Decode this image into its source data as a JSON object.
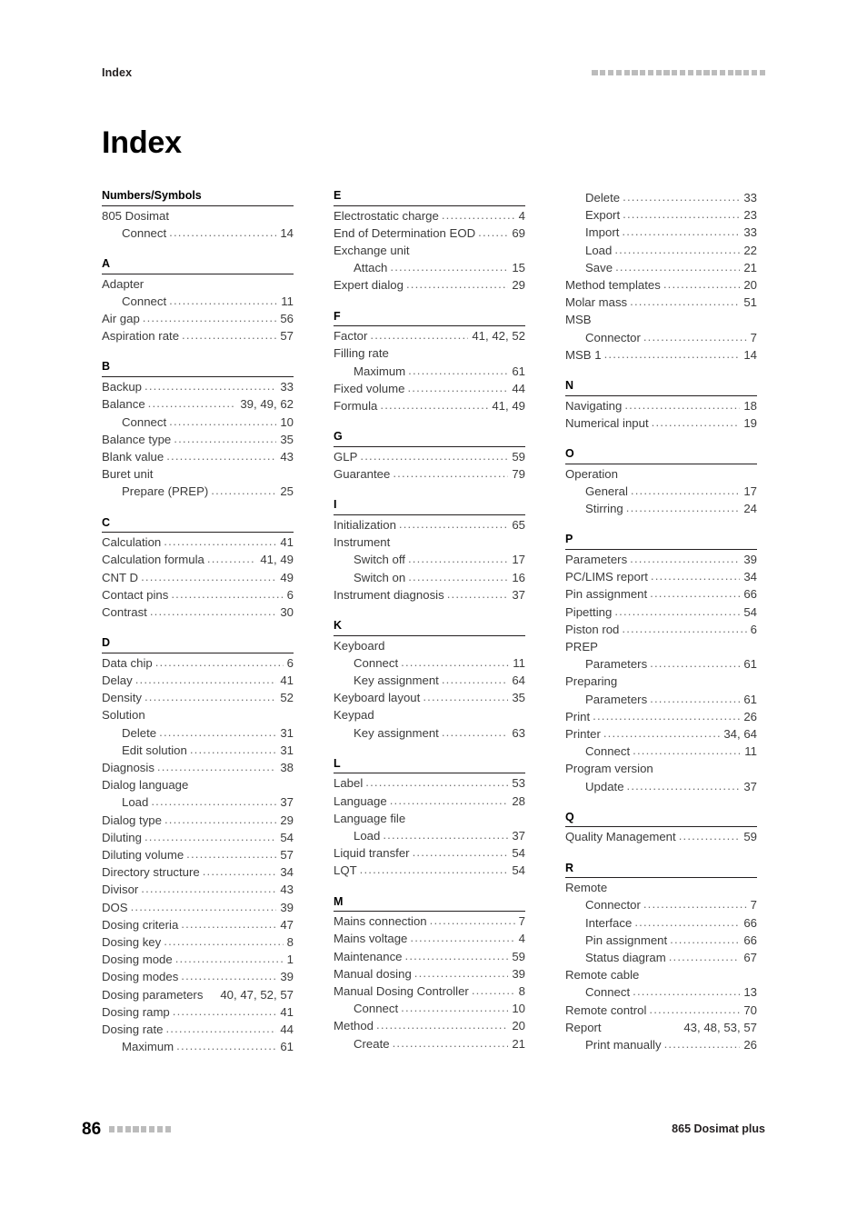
{
  "header": {
    "running_title": "Index",
    "decoration_squares": 22
  },
  "title": "Index",
  "footer": {
    "page_number": "86",
    "decoration_squares": 8,
    "document_title": "865 Dosimat plus"
  },
  "columns": [
    {
      "id": "column-1",
      "sections": [
        {
          "letter": "Numbers/Symbols",
          "entries": [
            {
              "text": "805 Dosimat",
              "pages": "",
              "level": 0,
              "dots": false
            },
            {
              "text": "Connect",
              "pages": "14",
              "level": 1,
              "dots": true
            }
          ]
        },
        {
          "letter": "A",
          "entries": [
            {
              "text": "Adapter",
              "pages": "",
              "level": 0,
              "dots": false
            },
            {
              "text": "Connect",
              "pages": "11",
              "level": 1,
              "dots": true
            },
            {
              "text": "Air gap",
              "pages": "56",
              "level": 0,
              "dots": true
            },
            {
              "text": "Aspiration rate",
              "pages": "57",
              "level": 0,
              "dots": true
            }
          ]
        },
        {
          "letter": "B",
          "entries": [
            {
              "text": "Backup",
              "pages": "33",
              "level": 0,
              "dots": true
            },
            {
              "text": "Balance",
              "pages": "39, 49, 62",
              "level": 0,
              "dots": true
            },
            {
              "text": "Connect",
              "pages": "10",
              "level": 1,
              "dots": true
            },
            {
              "text": "Balance type",
              "pages": "35",
              "level": 0,
              "dots": true
            },
            {
              "text": "Blank value",
              "pages": "43",
              "level": 0,
              "dots": true
            },
            {
              "text": "Buret unit",
              "pages": "",
              "level": 0,
              "dots": false
            },
            {
              "text": "Prepare (PREP)",
              "pages": "25",
              "level": 1,
              "dots": true
            }
          ]
        },
        {
          "letter": "C",
          "entries": [
            {
              "text": "Calculation",
              "pages": "41",
              "level": 0,
              "dots": true
            },
            {
              "text": "Calculation formula",
              "pages": "41, 49",
              "level": 0,
              "dots": true
            },
            {
              "text": "CNT D",
              "pages": "49",
              "level": 0,
              "dots": true
            },
            {
              "text": "Contact pins",
              "pages": "6",
              "level": 0,
              "dots": true
            },
            {
              "text": "Contrast",
              "pages": "30",
              "level": 0,
              "dots": true
            }
          ]
        },
        {
          "letter": "D",
          "entries": [
            {
              "text": "Data chip",
              "pages": "6",
              "level": 0,
              "dots": true
            },
            {
              "text": "Delay",
              "pages": "41",
              "level": 0,
              "dots": true
            },
            {
              "text": "Density",
              "pages": "52",
              "level": 0,
              "dots": true
            },
            {
              "text": "Solution",
              "pages": "",
              "level": 0,
              "dots": false
            },
            {
              "text": "Delete",
              "pages": "31",
              "level": 1,
              "dots": true
            },
            {
              "text": "Edit solution",
              "pages": "31",
              "level": 1,
              "dots": true
            },
            {
              "text": "Diagnosis",
              "pages": "38",
              "level": 0,
              "dots": true
            },
            {
              "text": "Dialog language",
              "pages": "",
              "level": 0,
              "dots": false
            },
            {
              "text": "Load",
              "pages": "37",
              "level": 1,
              "dots": true
            },
            {
              "text": "Dialog type",
              "pages": "29",
              "level": 0,
              "dots": true
            },
            {
              "text": "Diluting",
              "pages": "54",
              "level": 0,
              "dots": true
            },
            {
              "text": "Diluting volume",
              "pages": "57",
              "level": 0,
              "dots": true
            },
            {
              "text": "Directory structure",
              "pages": "34",
              "level": 0,
              "dots": true
            },
            {
              "text": "Divisor",
              "pages": "43",
              "level": 0,
              "dots": true
            },
            {
              "text": "DOS",
              "pages": "39",
              "level": 0,
              "dots": true
            },
            {
              "text": "Dosing criteria",
              "pages": "47",
              "level": 0,
              "dots": true
            },
            {
              "text": "Dosing key",
              "pages": "8",
              "level": 0,
              "dots": true
            },
            {
              "text": "Dosing mode",
              "pages": "1",
              "level": 0,
              "dots": true
            },
            {
              "text": "Dosing modes",
              "pages": "39",
              "level": 0,
              "dots": true
            },
            {
              "text": "Dosing parameters",
              "pages": "40, 47, 52, 57",
              "level": 0,
              "dots": false
            },
            {
              "text": "Dosing ramp",
              "pages": "41",
              "level": 0,
              "dots": true
            },
            {
              "text": "Dosing rate",
              "pages": "44",
              "level": 0,
              "dots": true
            },
            {
              "text": "Maximum",
              "pages": "61",
              "level": 1,
              "dots": true
            }
          ]
        }
      ]
    },
    {
      "id": "column-2",
      "sections": [
        {
          "letter": "E",
          "entries": [
            {
              "text": "Electrostatic charge",
              "pages": "4",
              "level": 0,
              "dots": true
            },
            {
              "text": "End of Determination EOD",
              "pages": "69",
              "level": 0,
              "dots": true
            },
            {
              "text": "Exchange unit",
              "pages": "",
              "level": 0,
              "dots": false
            },
            {
              "text": "Attach",
              "pages": "15",
              "level": 1,
              "dots": true
            },
            {
              "text": "Expert dialog",
              "pages": "29",
              "level": 0,
              "dots": true
            }
          ]
        },
        {
          "letter": "F",
          "entries": [
            {
              "text": "Factor",
              "pages": "41, 42, 52",
              "level": 0,
              "dots": true
            },
            {
              "text": "Filling rate",
              "pages": "",
              "level": 0,
              "dots": false
            },
            {
              "text": "Maximum",
              "pages": "61",
              "level": 1,
              "dots": true
            },
            {
              "text": "Fixed volume",
              "pages": "44",
              "level": 0,
              "dots": true
            },
            {
              "text": "Formula",
              "pages": "41, 49",
              "level": 0,
              "dots": true
            }
          ]
        },
        {
          "letter": "G",
          "entries": [
            {
              "text": "GLP",
              "pages": "59",
              "level": 0,
              "dots": true
            },
            {
              "text": "Guarantee",
              "pages": "79",
              "level": 0,
              "dots": true
            }
          ]
        },
        {
          "letter": "I",
          "entries": [
            {
              "text": "Initialization",
              "pages": "65",
              "level": 0,
              "dots": true
            },
            {
              "text": "Instrument",
              "pages": "",
              "level": 0,
              "dots": false
            },
            {
              "text": "Switch off",
              "pages": "17",
              "level": 1,
              "dots": true
            },
            {
              "text": "Switch on",
              "pages": "16",
              "level": 1,
              "dots": true
            },
            {
              "text": "Instrument diagnosis",
              "pages": "37",
              "level": 0,
              "dots": true
            }
          ]
        },
        {
          "letter": "K",
          "entries": [
            {
              "text": "Keyboard",
              "pages": "",
              "level": 0,
              "dots": false
            },
            {
              "text": "Connect",
              "pages": "11",
              "level": 1,
              "dots": true
            },
            {
              "text": "Key assignment",
              "pages": "64",
              "level": 1,
              "dots": true
            },
            {
              "text": "Keyboard layout",
              "pages": "35",
              "level": 0,
              "dots": true
            },
            {
              "text": "Keypad",
              "pages": "",
              "level": 0,
              "dots": false
            },
            {
              "text": "Key assignment",
              "pages": "63",
              "level": 1,
              "dots": true
            }
          ]
        },
        {
          "letter": "L",
          "entries": [
            {
              "text": "Label",
              "pages": "53",
              "level": 0,
              "dots": true
            },
            {
              "text": "Language",
              "pages": "28",
              "level": 0,
              "dots": true
            },
            {
              "text": "Language file",
              "pages": "",
              "level": 0,
              "dots": false
            },
            {
              "text": "Load",
              "pages": "37",
              "level": 1,
              "dots": true
            },
            {
              "text": "Liquid transfer",
              "pages": "54",
              "level": 0,
              "dots": true
            },
            {
              "text": "LQT",
              "pages": "54",
              "level": 0,
              "dots": true
            }
          ]
        },
        {
          "letter": "M",
          "entries": [
            {
              "text": "Mains connection",
              "pages": "7",
              "level": 0,
              "dots": true
            },
            {
              "text": "Mains voltage",
              "pages": "4",
              "level": 0,
              "dots": true
            },
            {
              "text": "Maintenance",
              "pages": "59",
              "level": 0,
              "dots": true
            },
            {
              "text": "Manual dosing",
              "pages": "39",
              "level": 0,
              "dots": true
            },
            {
              "text": "Manual Dosing Controller",
              "pages": "8",
              "level": 0,
              "dots": true
            },
            {
              "text": "Connect",
              "pages": "10",
              "level": 1,
              "dots": true
            },
            {
              "text": "Method",
              "pages": "20",
              "level": 0,
              "dots": true
            },
            {
              "text": "Create",
              "pages": "21",
              "level": 1,
              "dots": true
            }
          ]
        }
      ]
    },
    {
      "id": "column-3",
      "sections": [
        {
          "letter": "",
          "entries": [
            {
              "text": "Delete",
              "pages": "33",
              "level": 1,
              "dots": true
            },
            {
              "text": "Export",
              "pages": "23",
              "level": 1,
              "dots": true
            },
            {
              "text": "Import",
              "pages": "33",
              "level": 1,
              "dots": true
            },
            {
              "text": "Load",
              "pages": "22",
              "level": 1,
              "dots": true
            },
            {
              "text": "Save",
              "pages": "21",
              "level": 1,
              "dots": true
            },
            {
              "text": "Method templates",
              "pages": "20",
              "level": 0,
              "dots": true
            },
            {
              "text": "Molar mass",
              "pages": "51",
              "level": 0,
              "dots": true
            },
            {
              "text": "MSB",
              "pages": "",
              "level": 0,
              "dots": false
            },
            {
              "text": "Connector",
              "pages": "7",
              "level": 1,
              "dots": true
            },
            {
              "text": "MSB 1",
              "pages": "14",
              "level": 0,
              "dots": true
            }
          ]
        },
        {
          "letter": "N",
          "entries": [
            {
              "text": "Navigating",
              "pages": "18",
              "level": 0,
              "dots": true
            },
            {
              "text": "Numerical input",
              "pages": "19",
              "level": 0,
              "dots": true
            }
          ]
        },
        {
          "letter": "O",
          "entries": [
            {
              "text": "Operation",
              "pages": "",
              "level": 0,
              "dots": false
            },
            {
              "text": "General",
              "pages": "17",
              "level": 1,
              "dots": true
            },
            {
              "text": "Stirring",
              "pages": "24",
              "level": 1,
              "dots": true
            }
          ]
        },
        {
          "letter": "P",
          "entries": [
            {
              "text": "Parameters",
              "pages": "39",
              "level": 0,
              "dots": true
            },
            {
              "text": "PC/LIMS report",
              "pages": "34",
              "level": 0,
              "dots": true
            },
            {
              "text": "Pin assignment",
              "pages": "66",
              "level": 0,
              "dots": true
            },
            {
              "text": "Pipetting",
              "pages": "54",
              "level": 0,
              "dots": true
            },
            {
              "text": "Piston rod",
              "pages": "6",
              "level": 0,
              "dots": true
            },
            {
              "text": "PREP",
              "pages": "",
              "level": 0,
              "dots": false
            },
            {
              "text": "Parameters",
              "pages": "61",
              "level": 1,
              "dots": true
            },
            {
              "text": "Preparing",
              "pages": "",
              "level": 0,
              "dots": false
            },
            {
              "text": "Parameters",
              "pages": "61",
              "level": 1,
              "dots": true
            },
            {
              "text": "Print",
              "pages": "26",
              "level": 0,
              "dots": true
            },
            {
              "text": "Printer",
              "pages": "34, 64",
              "level": 0,
              "dots": true
            },
            {
              "text": "Connect",
              "pages": "11",
              "level": 1,
              "dots": true
            },
            {
              "text": "Program version",
              "pages": "",
              "level": 0,
              "dots": false
            },
            {
              "text": "Update",
              "pages": "37",
              "level": 1,
              "dots": true
            }
          ]
        },
        {
          "letter": "Q",
          "entries": [
            {
              "text": "Quality Management",
              "pages": "59",
              "level": 0,
              "dots": true
            }
          ]
        },
        {
          "letter": "R",
          "entries": [
            {
              "text": "Remote",
              "pages": "",
              "level": 0,
              "dots": false
            },
            {
              "text": "Connector",
              "pages": "7",
              "level": 1,
              "dots": true
            },
            {
              "text": "Interface",
              "pages": "66",
              "level": 1,
              "dots": true
            },
            {
              "text": "Pin assignment",
              "pages": "66",
              "level": 1,
              "dots": true
            },
            {
              "text": "Status diagram",
              "pages": "67",
              "level": 1,
              "dots": true
            },
            {
              "text": "Remote cable",
              "pages": "",
              "level": 0,
              "dots": false
            },
            {
              "text": "Connect",
              "pages": "13",
              "level": 1,
              "dots": true
            },
            {
              "text": "Remote control",
              "pages": "70",
              "level": 0,
              "dots": true
            },
            {
              "text": "Report",
              "pages": "43, 48, 53, 57",
              "level": 0,
              "dots": false
            },
            {
              "text": "Print manually",
              "pages": "26",
              "level": 1,
              "dots": true
            }
          ]
        }
      ]
    }
  ]
}
